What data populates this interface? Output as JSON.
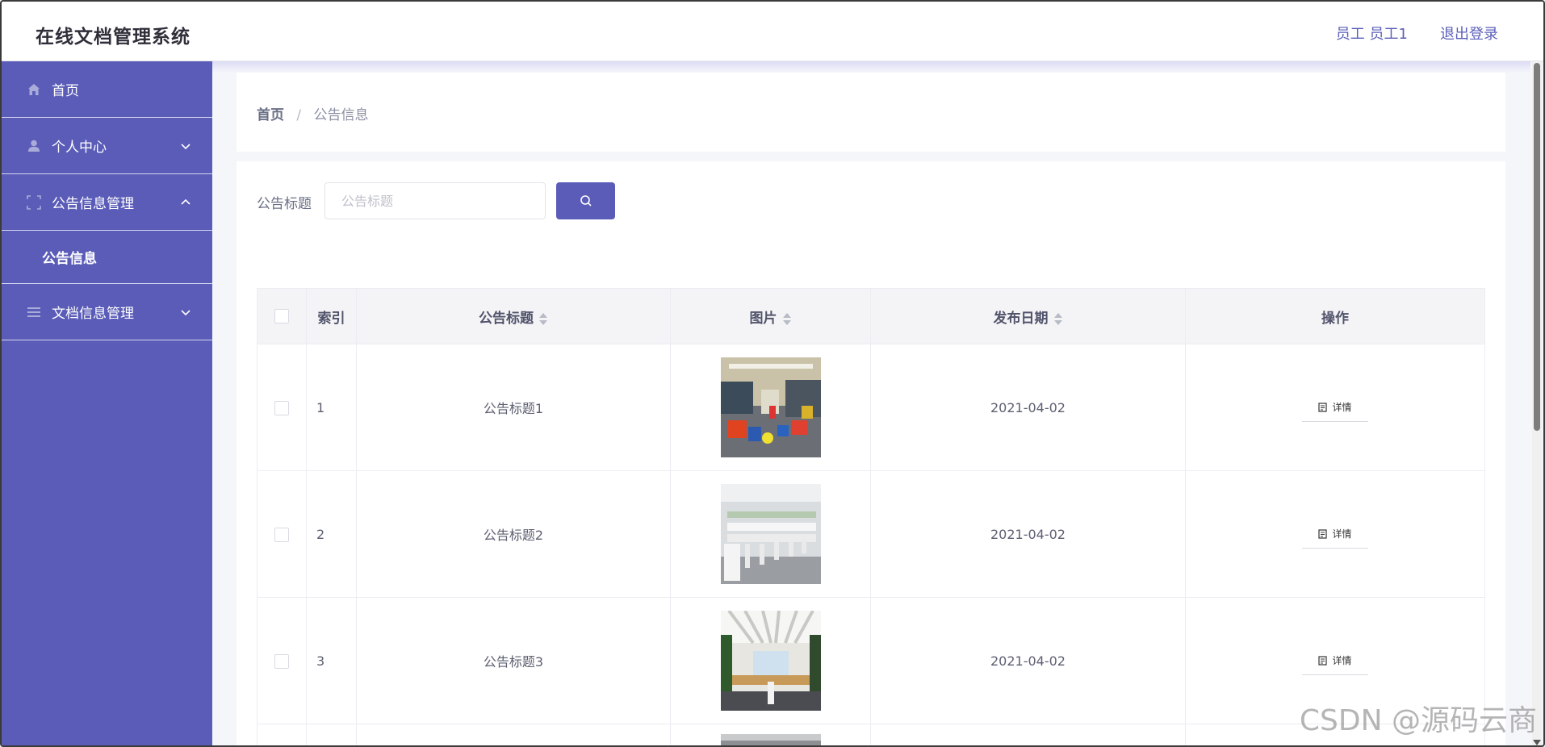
{
  "header": {
    "app_title": "在线文档管理系统",
    "user": "员工 员工1",
    "logout": "退出登录"
  },
  "sidebar": {
    "items": [
      {
        "label": "首页",
        "icon": "home-icon"
      },
      {
        "label": "个人中心",
        "icon": "user-icon",
        "expandable": true,
        "expanded": false
      },
      {
        "label": "公告信息管理",
        "icon": "announcement-icon",
        "expandable": true,
        "expanded": true,
        "children": [
          {
            "label": "公告信息"
          }
        ]
      },
      {
        "label": "文档信息管理",
        "icon": "list-icon",
        "expandable": true,
        "expanded": false
      }
    ]
  },
  "breadcrumb": {
    "home": "首页",
    "separator": "/",
    "current": "公告信息"
  },
  "search": {
    "label": "公告标题",
    "placeholder": "公告标题",
    "button_icon": "search-icon"
  },
  "table": {
    "columns": [
      "索引",
      "公告标题",
      "图片",
      "发布日期",
      "操作"
    ],
    "sortable": [
      "公告标题",
      "图片",
      "发布日期"
    ],
    "rows": [
      {
        "index": "1",
        "title": "公告标题1",
        "image": "office-photo-1",
        "date": "2021-04-02",
        "action": "详情"
      },
      {
        "index": "2",
        "title": "公告标题2",
        "image": "office-photo-2",
        "date": "2021-04-02",
        "action": "详情"
      },
      {
        "index": "3",
        "title": "公告标题3",
        "image": "office-photo-3",
        "date": "2021-04-02",
        "action": "详情"
      }
    ]
  },
  "colors": {
    "primary": "#5a5cb8",
    "header_bg": "#ffffff",
    "page_bg": "#f5f6fa"
  },
  "watermark": "CSDN @源码云商"
}
